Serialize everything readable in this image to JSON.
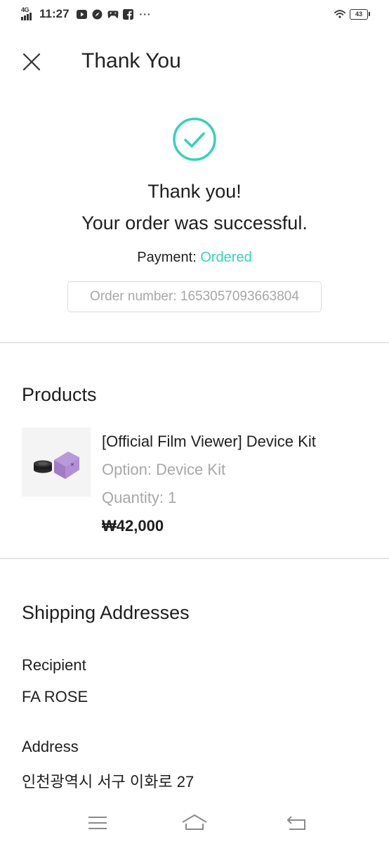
{
  "status_bar": {
    "time": "11:27",
    "network": "4G",
    "battery": "43",
    "more": "···",
    "icons": [
      "youtube-icon",
      "compass-icon",
      "game-controller-icon",
      "facebook-icon",
      "wifi-icon"
    ]
  },
  "header": {
    "title": "Thank You",
    "close_icon": "close-icon"
  },
  "success": {
    "icon": "check-circle-icon",
    "accent_color": "#33d3b9",
    "line1": "Thank you!",
    "line2": "Your order was successful.",
    "payment_label": "Payment:",
    "payment_status": "Ordered",
    "order_number": "Order number: 1653057093663804"
  },
  "products": {
    "title": "Products",
    "items": [
      {
        "name": "[Official Film Viewer] Device Kit",
        "option": "Option: Device Kit",
        "quantity": "Quantity: 1",
        "price": "₩42,000"
      }
    ]
  },
  "shipping": {
    "title": "Shipping Addresses",
    "recipient_label": "Recipient",
    "recipient_value": "FA ROSE",
    "address_label": "Address",
    "address_value": "인천광역시 서구 이화로 27"
  },
  "nav_bar": {
    "icons": [
      "menu-icon",
      "home-icon",
      "back-icon"
    ]
  }
}
